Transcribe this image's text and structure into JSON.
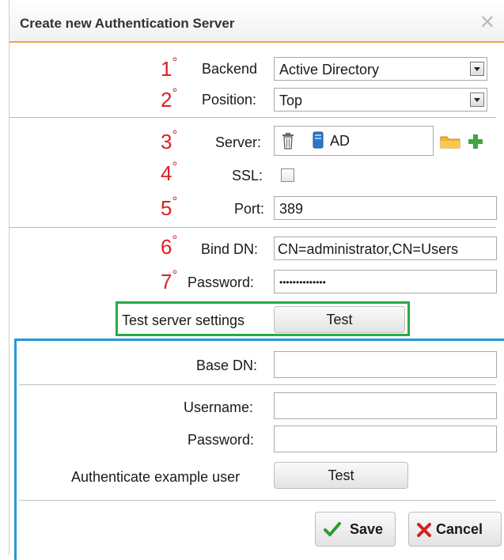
{
  "dialog": {
    "title": "Create new Authentication Server",
    "close_glyph": "✕"
  },
  "steps": [
    "1°",
    "2°",
    "3°",
    "4°",
    "5°",
    "6°",
    "7°"
  ],
  "backend": {
    "label": "Backend",
    "value": "Active Directory"
  },
  "position": {
    "label": "Position:",
    "value": "Top"
  },
  "server": {
    "label": "Server:",
    "value": "AD"
  },
  "ssl": {
    "label": "SSL:",
    "checked": false
  },
  "port": {
    "label": "Port:",
    "value": "389"
  },
  "bind_dn": {
    "label": "Bind DN:",
    "value": "CN=administrator,CN=Users"
  },
  "password": {
    "label": "Password:",
    "value": "••••••••••••••"
  },
  "test_server": {
    "label": "Test server settings",
    "button": "Test"
  },
  "base_dn": {
    "label": "Base DN:",
    "value": ""
  },
  "username": {
    "label": "Username:",
    "value": ""
  },
  "user_password": {
    "label": "Password:",
    "value": ""
  },
  "auth_example": {
    "label": "Authenticate example user",
    "button": "Test"
  },
  "footer": {
    "save": "Save",
    "cancel": "Cancel"
  },
  "colors": {
    "step": "#e02020",
    "green_box": "#2aa84a",
    "blue_box": "#1f9ad6",
    "title_underline": "#f0a04b"
  }
}
